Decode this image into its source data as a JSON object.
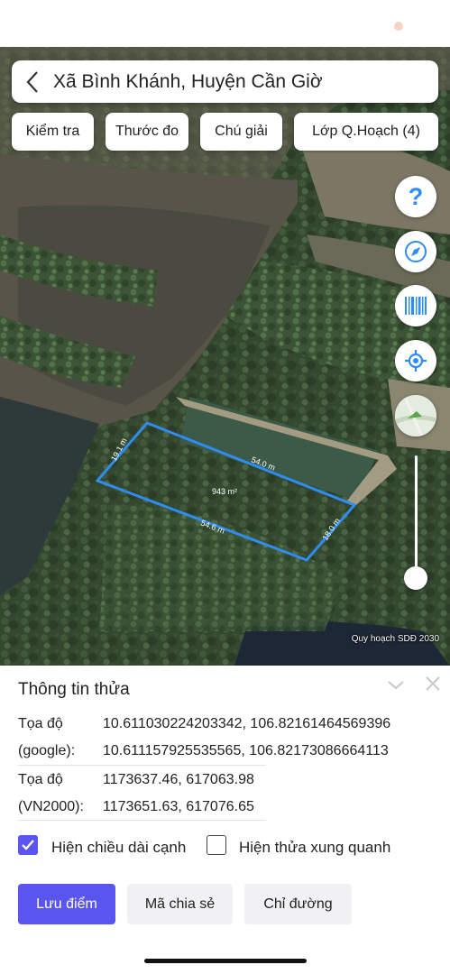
{
  "header": {
    "title": "Xã Bình Khánh, Huyện Cần Giờ"
  },
  "toolbar": {
    "check": "Kiểm tra",
    "measure": "Thước đo",
    "legend": "Chú giải",
    "layers": "Lớp Q.Hoạch (4)"
  },
  "map": {
    "watermark": "Quy hoạch SDĐ 2030",
    "parcel_color": "#2f8cf0",
    "edges": {
      "top": "54.0 m",
      "bottom": "54.6 m",
      "left": "19.1 m",
      "right": "18.0 m"
    },
    "area": "943 m²",
    "zoom_level": 0.1
  },
  "icons": {
    "help": "question-icon",
    "compass": "compass-icon",
    "barcode": "barcode-icon",
    "locate": "locate-icon"
  },
  "panel": {
    "title": "Thông tin thửa",
    "rows": [
      {
        "label": "Tọa độ",
        "value": "10.611030224203342, 106.82161464569396"
      },
      {
        "label": "(google):",
        "value": "10.611157925535565, 106.82173086664113"
      },
      {
        "label": "Tọa độ",
        "value": "1173637.46, 617063.98"
      },
      {
        "label": "(VN2000):",
        "value": "1173651.63, 617076.65"
      }
    ],
    "checkbox_edges": {
      "label": "Hiện chiều dài cạnh",
      "checked": true
    },
    "checkbox_neighbors": {
      "label": "Hiện thửa xung quanh",
      "checked": false
    },
    "buttons": {
      "save": "Lưu điểm",
      "share": "Mã chia sẻ",
      "directions": "Chỉ đường"
    },
    "accent": "#5a55ee"
  }
}
